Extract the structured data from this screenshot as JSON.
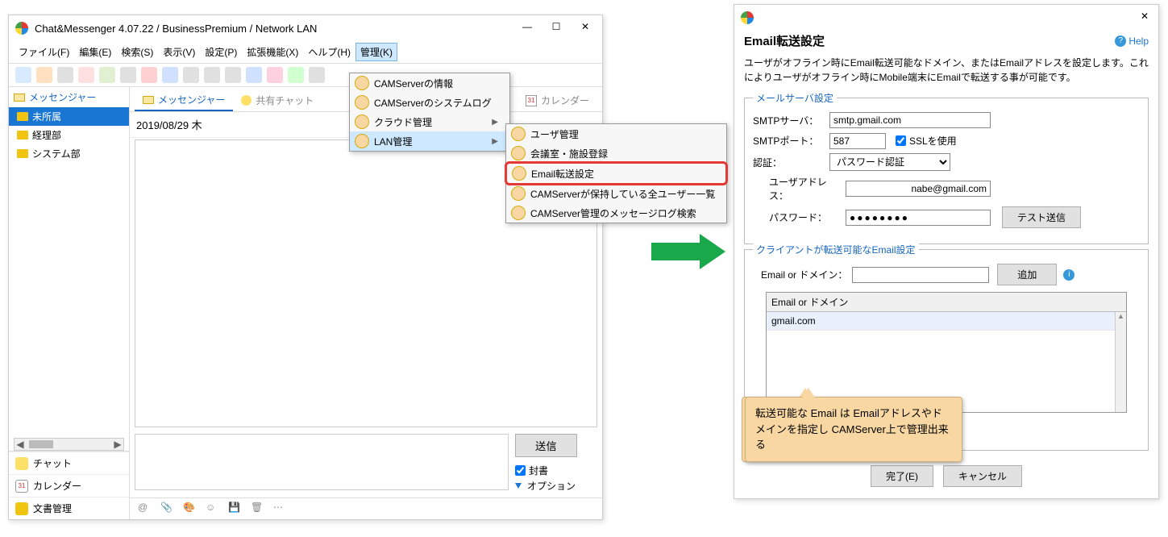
{
  "main_window": {
    "title": "Chat&Messenger 4.07.22 / BusinessPremium / Network LAN",
    "menubar": {
      "file": "ファイル(F)",
      "edit": "編集(E)",
      "search": "検索(S)",
      "view": "表示(V)",
      "settings": "設定(P)",
      "ext": "拡張機能(X)",
      "help": "ヘルプ(H)",
      "admin": "管理(K)"
    },
    "sidebar": {
      "header": "メッセンジャー",
      "folders": {
        "unassigned": "未所属",
        "accounting": "経理部",
        "system": "システム部"
      }
    },
    "leftnav": {
      "chat": "チャット",
      "calendar": "カレンダー",
      "docs": "文書管理"
    },
    "tabs": {
      "messenger": "メッセンジャー",
      "shared": "共有チャット",
      "calendar": "カレンダー"
    },
    "date_header": "2019/08/29 木",
    "send_btn": "送信",
    "sealed_chk": "封書",
    "options_link": "オプション"
  },
  "admin_menu": {
    "items": {
      "camserver_info": "CAMServerの情報",
      "camserver_syslog": "CAMServerのシステムログ",
      "cloud_mgmt": "クラウド管理",
      "lan_mgmt": "LAN管理"
    }
  },
  "lan_submenu": {
    "items": {
      "user_mgmt": "ユーザ管理",
      "room_reg": "会議室・施設登録",
      "email_fwd": "Email転送設定",
      "all_users": "CAMServerが保持している全ユーザー一覧",
      "msg_log": "CAMServer管理のメッセージログ検索"
    }
  },
  "dialog": {
    "title": "Email転送設定",
    "help": "Help",
    "description": "ユーザがオフライン時にEmail転送可能なドメイン、またはEmailアドレスを設定します。これによりユーザがオフライン時にMobile端末にEmailで転送する事が可能です。",
    "mail_server": {
      "legend": "メールサーバ設定",
      "smtp_server_label": "SMTPサーバ：",
      "smtp_server_value": "smtp.gmail.com",
      "smtp_port_label": "SMTPポート：",
      "smtp_port_value": "587",
      "ssl_label": "SSLを使用",
      "auth_label": "認証：",
      "auth_value": "パスワード認証",
      "user_addr_label": "ユーザアドレス：",
      "user_addr_value": "nabe@gmail.com",
      "password_label": "パスワード：",
      "password_value": "●●●●●●●●",
      "test_send_btn": "テスト送信"
    },
    "client_email": {
      "legend": "クライアントが転送可能なEmail設定",
      "input_label": "Email or ドメイン：",
      "add_btn": "追加",
      "table_header": "Email or ドメイン",
      "rows": {
        "r0": "gmail.com"
      }
    },
    "callout_text": "転送可能な Email は Emailアドレスやドメインを指定し CAMServer上で管理出来る",
    "done_btn": "完了(E)",
    "cancel_btn": "キャンセル"
  }
}
